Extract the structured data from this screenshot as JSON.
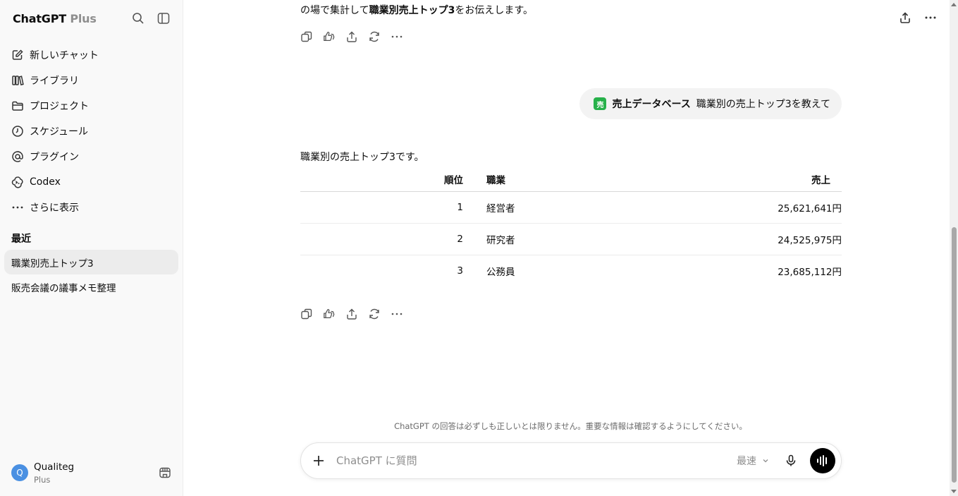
{
  "sidebar": {
    "brand": "ChatGPT",
    "brand_plan": "Plus",
    "nav": [
      {
        "label": "新しいチャット",
        "icon": "new-chat-icon"
      },
      {
        "label": "ライブラリ",
        "icon": "library-icon"
      },
      {
        "label": "プロジェクト",
        "icon": "folder-icon"
      },
      {
        "label": "スケジュール",
        "icon": "clock-icon"
      },
      {
        "label": "プラグイン",
        "icon": "at-icon"
      },
      {
        "label": "Codex",
        "icon": "codex-icon"
      },
      {
        "label": "さらに表示",
        "icon": "more-dots-icon"
      }
    ],
    "recent_title": "最近",
    "chats": [
      {
        "label": "職業別売上トップ3"
      },
      {
        "label": "販売会議の議事メモ整理"
      }
    ],
    "user": {
      "initial": "Q",
      "name": "Qualiteg",
      "plan": "Plus"
    }
  },
  "conversation": {
    "intro_prefix": "の場で集計して",
    "intro_bold": "職業別売上トップ3",
    "intro_suffix": "をお伝えします。",
    "user_message": {
      "badge": "売",
      "plugin_label": "売上データベース",
      "text": "職業別の売上トップ3を教えて"
    },
    "answer_lead": "職業別の売上トップ3です。",
    "table": {
      "headers": {
        "rank": "順位",
        "job": "職業",
        "sales": "売上"
      },
      "rows": [
        {
          "rank": "1",
          "job": "経営者",
          "sales": "25,621,641円"
        },
        {
          "rank": "2",
          "job": "研究者",
          "sales": "24,525,975円"
        },
        {
          "rank": "3",
          "job": "公務員",
          "sales": "23,685,112円"
        }
      ]
    }
  },
  "composer": {
    "placeholder": "ChatGPT に質問",
    "model": "最速",
    "disclaimer": "ChatGPT の回答は必ずしも正しいとは限りません。重要な情報は確認するようにしてください。"
  },
  "colors": {
    "accent": "#27b14a",
    "avatar": "#4a90e2",
    "sidebar_bg": "#f9f9f9"
  }
}
